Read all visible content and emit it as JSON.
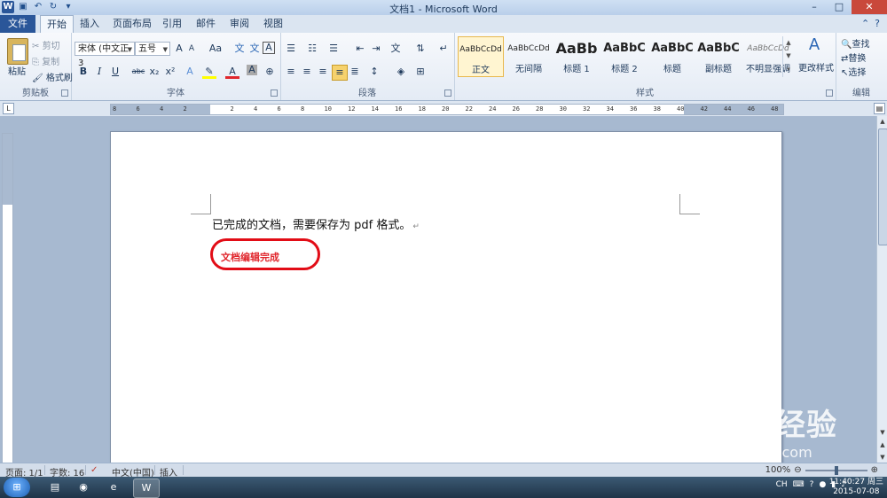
{
  "window": {
    "title": "文档1 - Microsoft Word",
    "minimize": "–",
    "maximize": "□",
    "close": "✕"
  },
  "tabs": [
    {
      "label": "文件"
    },
    {
      "label": "开始"
    },
    {
      "label": "插入"
    },
    {
      "label": "页面布局"
    },
    {
      "label": "引用"
    },
    {
      "label": "邮件"
    },
    {
      "label": "审阅"
    },
    {
      "label": "视图"
    }
  ],
  "clipboard": {
    "paste": "粘贴",
    "cut": "剪切",
    "copy": "复制",
    "format_painter": "格式刷",
    "group_label": "剪贴板"
  },
  "font": {
    "font_name": "宋体 (中文正3",
    "font_size": "五号",
    "bold": "B",
    "italic": "I",
    "underline": "U",
    "strike": "abc",
    "subscript": "x₂",
    "superscript": "x²",
    "change_case": "Aa",
    "grow": "A",
    "shrink": "A",
    "group_label": "字体"
  },
  "paragraph": {
    "group_label": "段落"
  },
  "styles": {
    "items": [
      {
        "sample": "AaBbCcDd",
        "name": "正文"
      },
      {
        "sample": "AaBbCcDd",
        "name": "无间隔"
      },
      {
        "sample": "AaBb",
        "name": "标题 1"
      },
      {
        "sample": "AaBbC",
        "name": "标题 2"
      },
      {
        "sample": "AaBbC",
        "name": "标题"
      },
      {
        "sample": "AaBbC",
        "name": "副标题"
      },
      {
        "sample": "AaBbCcDd",
        "name": "不明显强调"
      }
    ],
    "change_styles": "更改样式",
    "group_label": "样式"
  },
  "editing": {
    "find": "查找",
    "replace": "替换",
    "select": "选择",
    "group_label": "编辑"
  },
  "ruler": {
    "ticks": [
      "8",
      "6",
      "4",
      "2",
      "",
      "2",
      "4",
      "6",
      "8",
      "10",
      "12",
      "14",
      "16",
      "18",
      "20",
      "22",
      "24",
      "26",
      "28",
      "30",
      "32",
      "34",
      "36",
      "38",
      "40",
      "42",
      "44",
      "46",
      "48"
    ]
  },
  "document": {
    "paragraph1": "已完成的文档，需要保存为 pdf 格式。",
    "paragraph_mark": "↵",
    "paragraph2": "文档编辑完成"
  },
  "status": {
    "page": "页面: 1/1",
    "words": "字数: 16",
    "language": "中文(中国)",
    "mode": "插入",
    "zoom": "100%"
  },
  "taskbar": {
    "start": "⊞",
    "ime": "CH",
    "time": "11:40:27 周三",
    "date": "2015-07-08"
  },
  "watermark": {
    "brand": "Baidu经验",
    "url": "jingyan.baidu.com"
  }
}
